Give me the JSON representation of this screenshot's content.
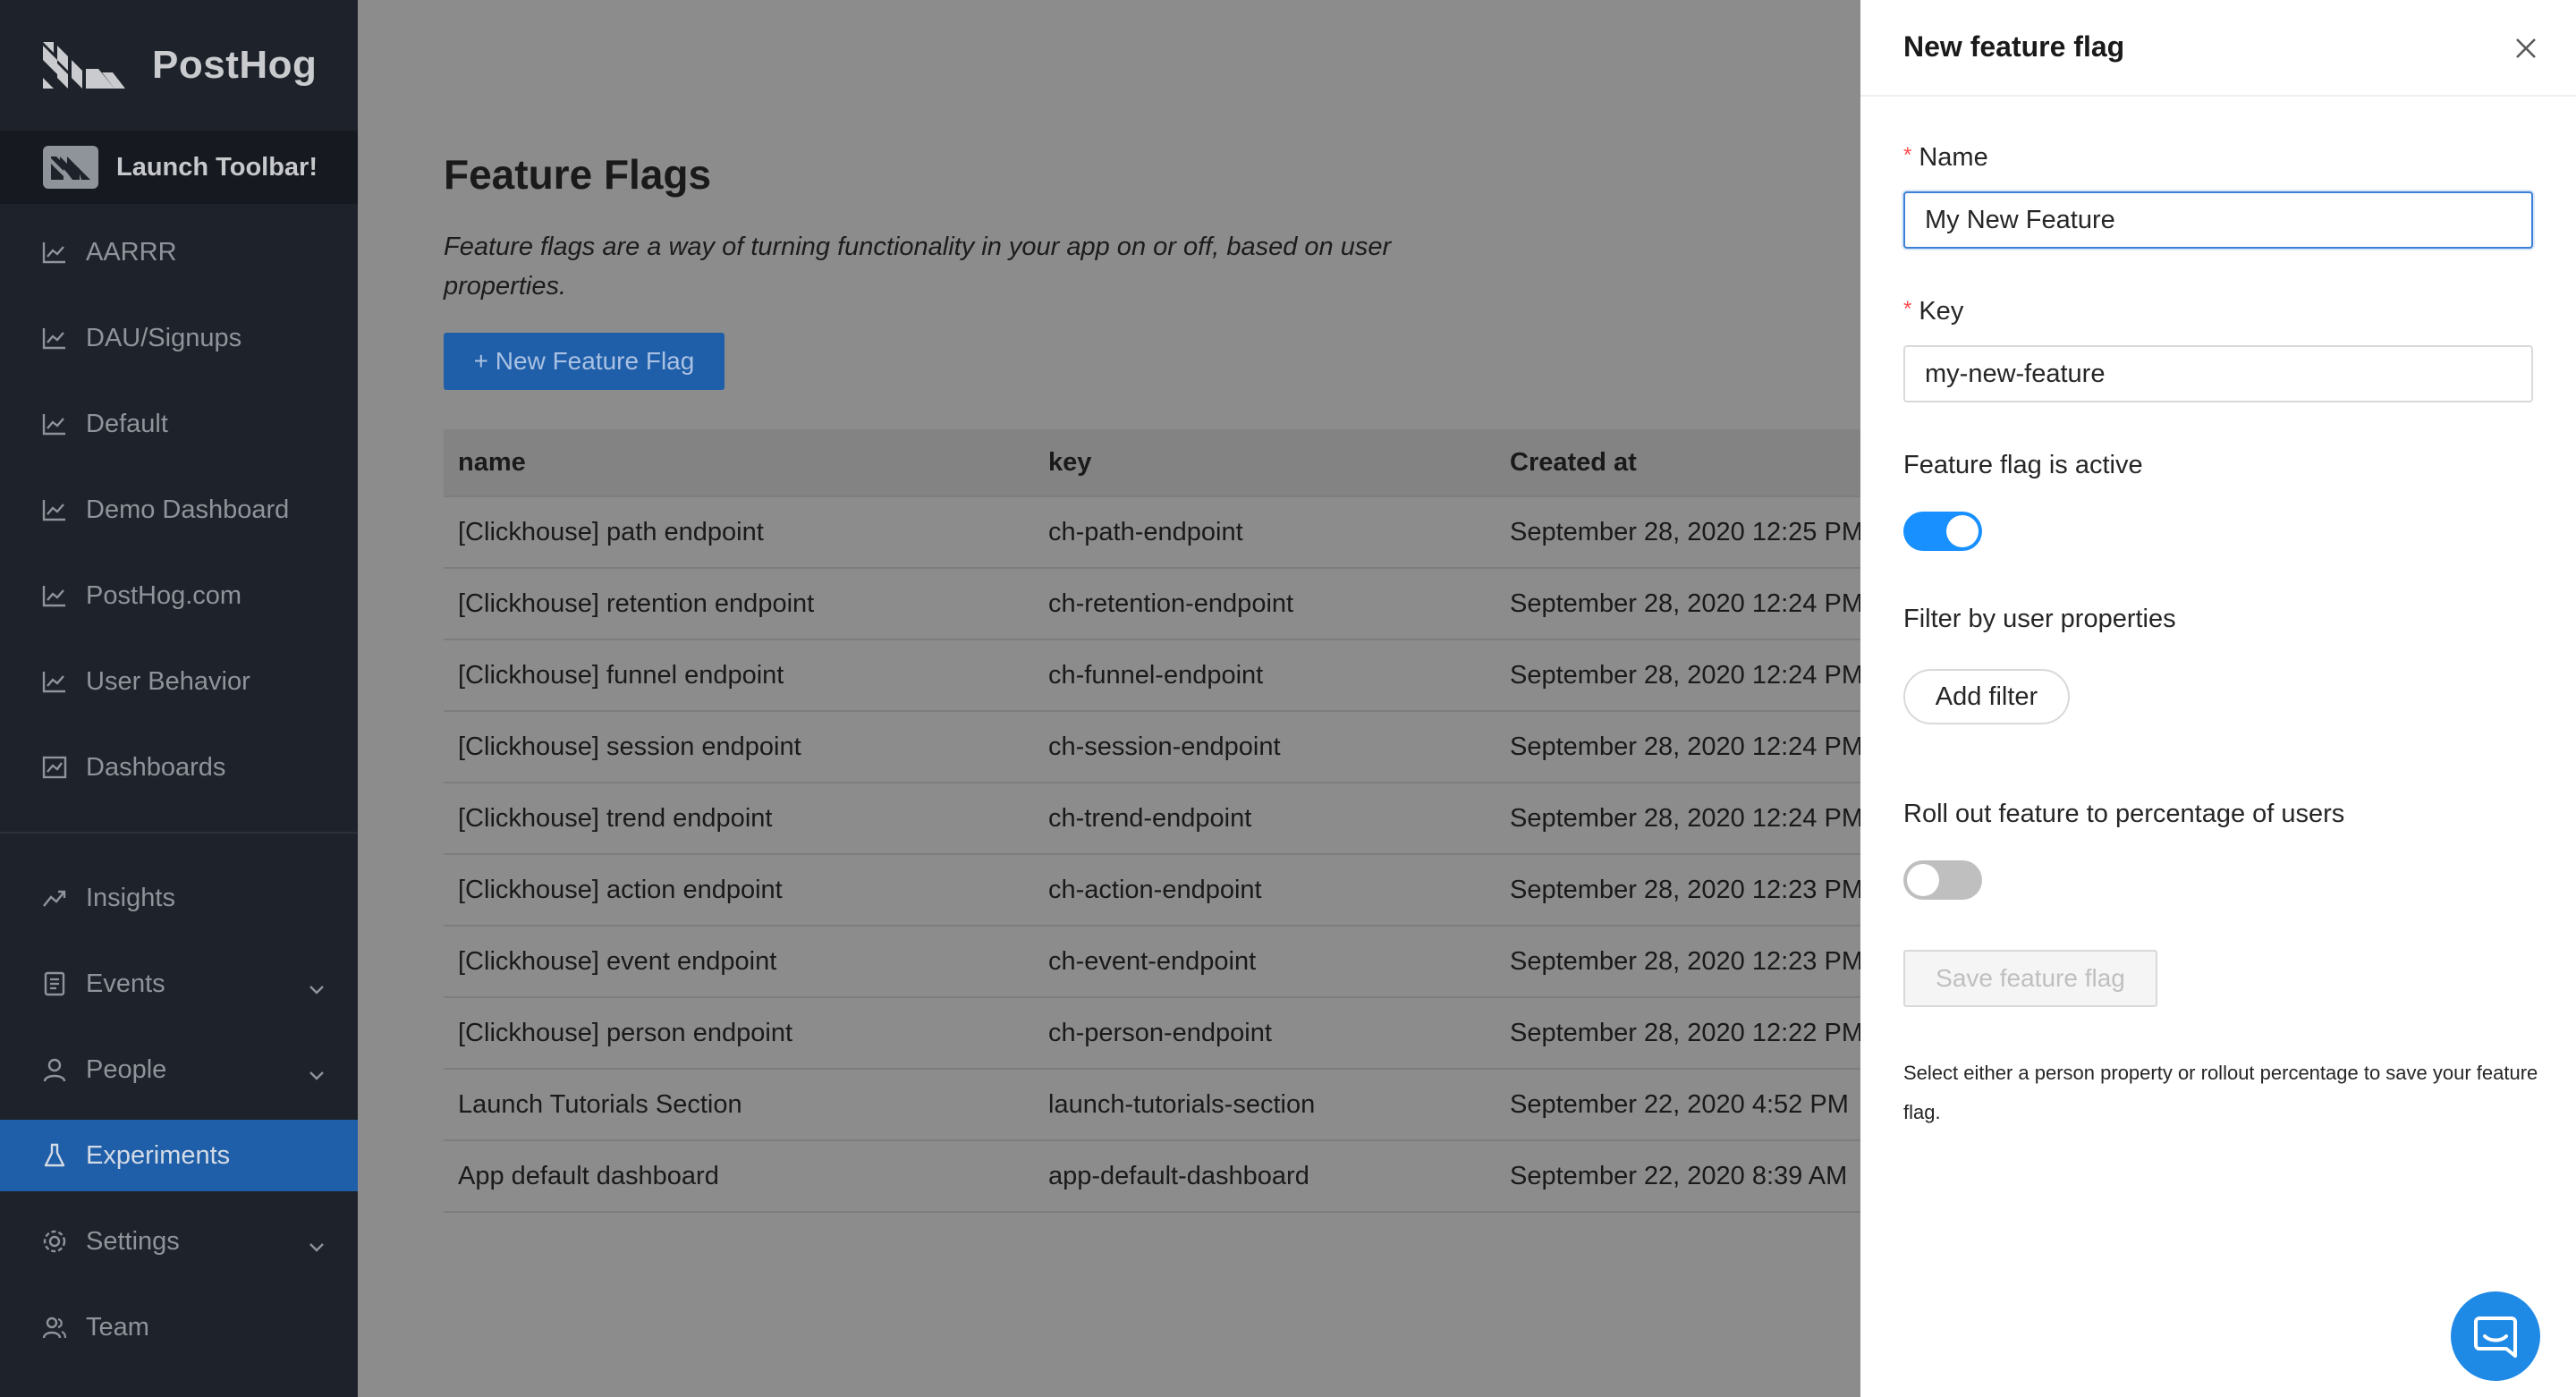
{
  "sidebar": {
    "brand": "PostHog",
    "toolbar_label": "Launch Toolbar!",
    "items": [
      {
        "label": "AARRR",
        "icon": "line-chart-icon"
      },
      {
        "label": "DAU/Signups",
        "icon": "line-chart-icon"
      },
      {
        "label": "Default",
        "icon": "line-chart-icon"
      },
      {
        "label": "Demo Dashboard",
        "icon": "line-chart-icon"
      },
      {
        "label": "PostHog.com",
        "icon": "line-chart-icon"
      },
      {
        "label": "User Behavior",
        "icon": "line-chart-icon"
      },
      {
        "label": "Dashboards",
        "icon": "dashboard-icon"
      },
      {
        "label": "Insights",
        "icon": "rise-icon"
      },
      {
        "label": "Events",
        "icon": "events-icon"
      },
      {
        "label": "People",
        "icon": "user-icon"
      },
      {
        "label": "Experiments",
        "icon": "flask-icon"
      },
      {
        "label": "Settings",
        "icon": "gear-icon"
      },
      {
        "label": "Team",
        "icon": "team-icon"
      }
    ],
    "active_item": "Experiments",
    "active_color": "#1f5ea8"
  },
  "main": {
    "title": "Feature Flags",
    "description": "Feature flags are a way of turning functionality in your app on or off, based on user properties.",
    "new_button": "+ New Feature Flag",
    "table": {
      "headers": [
        "name",
        "key",
        "Created at"
      ],
      "rows": [
        [
          "[Clickhouse] path endpoint",
          "ch-path-endpoint",
          "September 28, 2020 12:25 PM"
        ],
        [
          "[Clickhouse] retention endpoint",
          "ch-retention-endpoint",
          "September 28, 2020 12:24 PM"
        ],
        [
          "[Clickhouse] funnel endpoint",
          "ch-funnel-endpoint",
          "September 28, 2020 12:24 PM"
        ],
        [
          "[Clickhouse] session endpoint",
          "ch-session-endpoint",
          "September 28, 2020 12:24 PM"
        ],
        [
          "[Clickhouse] trend endpoint",
          "ch-trend-endpoint",
          "September 28, 2020 12:24 PM"
        ],
        [
          "[Clickhouse] action endpoint",
          "ch-action-endpoint",
          "September 28, 2020 12:23 PM"
        ],
        [
          "[Clickhouse] event endpoint",
          "ch-event-endpoint",
          "September 28, 2020 12:23 PM"
        ],
        [
          "[Clickhouse] person endpoint",
          "ch-person-endpoint",
          "September 28, 2020 12:22 PM"
        ],
        [
          "Launch Tutorials Section",
          "launch-tutorials-section",
          "September 22, 2020 4:52 PM"
        ],
        [
          "App default dashboard",
          "app-default-dashboard",
          "September 22, 2020 8:39 AM"
        ]
      ]
    }
  },
  "drawer": {
    "title": "New feature flag",
    "name_label": "Name",
    "name_value": "My New Feature",
    "key_label": "Key",
    "key_value": "my-new-feature",
    "active_label": "Feature flag is active",
    "active": true,
    "filter_label": "Filter by user properties",
    "add_filter": "Add filter",
    "rollout_label": "Roll out feature to percentage of users",
    "rollout": false,
    "save_button": "Save feature flag",
    "hint": "Select either a person property or rollout percentage to save your feature flag."
  },
  "colors": {
    "primary": "#1890ff",
    "sidebar_bg": "#1e222a"
  }
}
